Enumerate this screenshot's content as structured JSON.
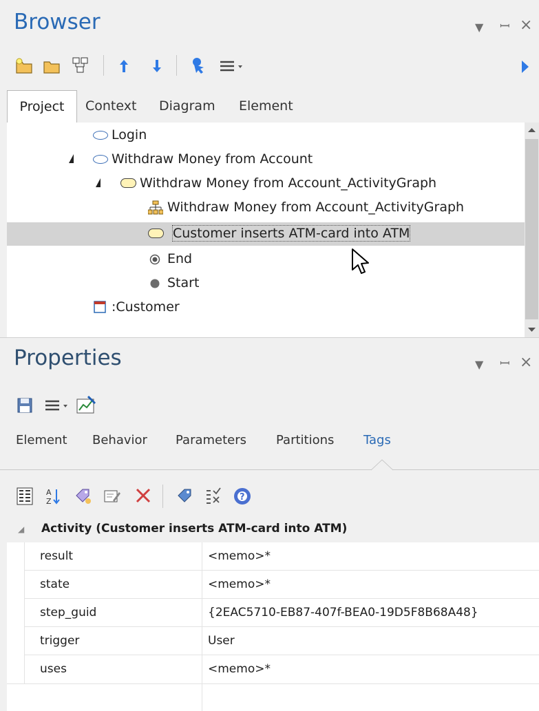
{
  "browser": {
    "title": "Browser",
    "tabs": [
      "Project",
      "Context",
      "Diagram",
      "Element"
    ],
    "active_tab": "Project",
    "tree": [
      {
        "label": "Login",
        "icon": "use-case-icon",
        "expanded": null
      },
      {
        "label": "Withdraw Money from Account",
        "icon": "use-case-icon",
        "expanded": true
      },
      {
        "label": "Withdraw Money from Account_ActivityGraph",
        "icon": "activity-icon",
        "expanded": true
      },
      {
        "label": "Withdraw Money from Account_ActivityGraph",
        "icon": "activity-diagram-icon",
        "expanded": null
      },
      {
        "label": "Customer inserts ATM-card into ATM",
        "icon": "activity-icon",
        "expanded": null,
        "selected": true
      },
      {
        "label": "End",
        "icon": "final-node-icon",
        "expanded": null
      },
      {
        "label": "Start",
        "icon": "initial-node-icon",
        "expanded": null
      },
      {
        "label": ":Customer",
        "icon": "object-icon",
        "expanded": null
      }
    ]
  },
  "properties": {
    "title": "Properties",
    "tabs": [
      "Element",
      "Behavior",
      "Parameters",
      "Partitions",
      "Tags"
    ],
    "active_tab": "Tags",
    "group_label": "Activity (Customer inserts ATM-card into ATM)",
    "rows": [
      {
        "name": "result",
        "value": "<memo>*"
      },
      {
        "name": "state",
        "value": "<memo>*"
      },
      {
        "name": "step_guid",
        "value": "{2EAC5710-EB87-407f-BEA0-19D5F8B68A48}"
      },
      {
        "name": "trigger",
        "value": "User"
      },
      {
        "name": "uses",
        "value": "<memo>*"
      }
    ]
  },
  "colors": {
    "title": "#2a6ab5",
    "selection": "#d3d3d3",
    "toolbar_blue": "#2f7ae5"
  }
}
